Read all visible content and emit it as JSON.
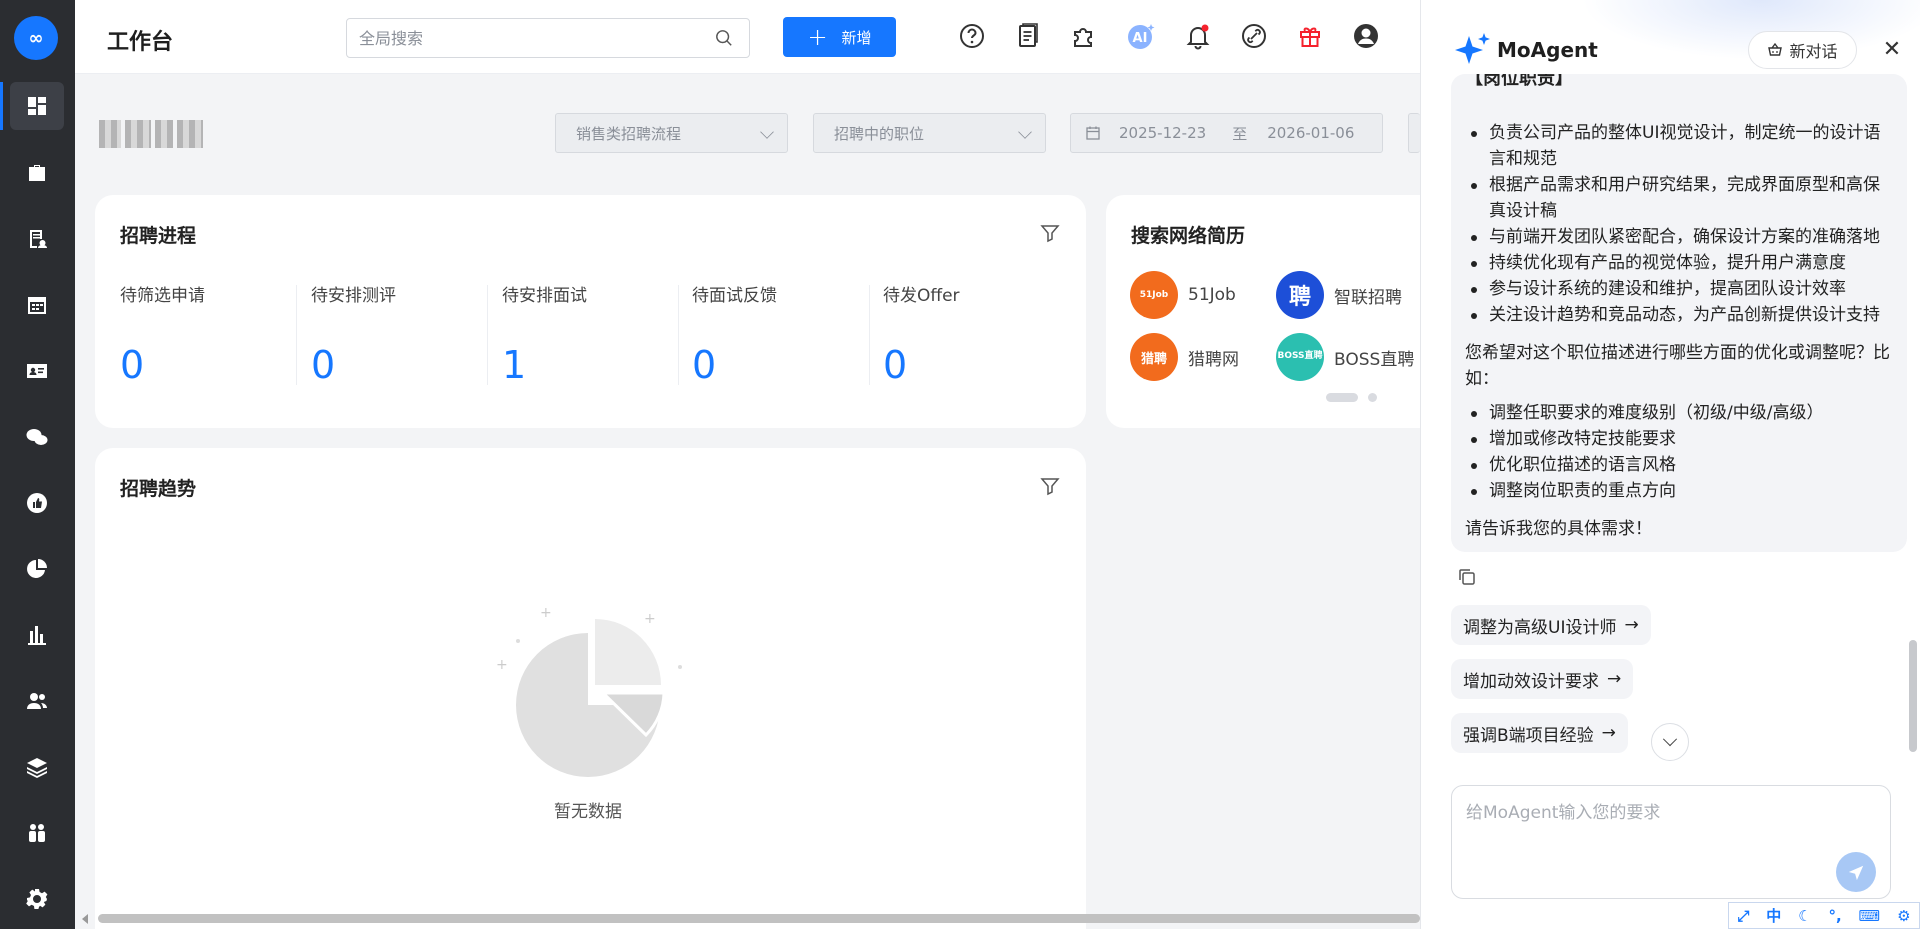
{
  "app": {
    "logo_text": "∞"
  },
  "sidebar": {
    "items": [
      {
        "name": "dashboard"
      },
      {
        "name": "jobs"
      },
      {
        "name": "resume"
      },
      {
        "name": "calendar"
      },
      {
        "name": "candidates"
      },
      {
        "name": "wechat"
      },
      {
        "name": "recommend"
      },
      {
        "name": "reports-pie"
      },
      {
        "name": "statistics"
      },
      {
        "name": "users"
      },
      {
        "name": "layers"
      },
      {
        "name": "team"
      },
      {
        "name": "settings"
      }
    ]
  },
  "header": {
    "title": "工作台",
    "search_placeholder": "全局搜索",
    "new_button": "新增"
  },
  "filters": {
    "process": "销售类招聘流程",
    "position": "招聘中的职位",
    "date_start": "2025-12-23",
    "date_sep": "至",
    "date_end": "2026-01-06"
  },
  "progress_card": {
    "title": "招聘进程",
    "stats": [
      {
        "label": "待筛选申请",
        "value": "0"
      },
      {
        "label": "待安排测评",
        "value": "0"
      },
      {
        "label": "待安排面试",
        "value": "1"
      },
      {
        "label": "待面试反馈",
        "value": "0"
      },
      {
        "label": "待发Offer",
        "value": "0"
      }
    ]
  },
  "resume_card": {
    "title": "搜索网络简历",
    "sites": [
      {
        "name": "51Job",
        "color": "#f26b1d",
        "badge": "51Job"
      },
      {
        "name": "智联招聘",
        "color": "#1d4fd8",
        "badge": "聘"
      },
      {
        "name": "猎聘网",
        "color": "#f26b1d",
        "badge": "猎聘"
      },
      {
        "name": "BOSS直聘",
        "color": "#2bbfb0",
        "badge": "BOSS直聘"
      }
    ]
  },
  "trend_card": {
    "title": "招聘趋势",
    "empty_text": "暂无数据"
  },
  "agent": {
    "title": "MoAgent",
    "new_chat": "新对话",
    "section_head": "【岗位职责】",
    "duties": [
      "负责公司产品的整体UI视觉设计，制定统一的设计语言和规范",
      "根据产品需求和用户研究结果，完成界面原型和高保真设计稿",
      "与前端开发团队紧密配合，确保设计方案的准确落地",
      "持续优化现有产品的视觉体验，提升用户满意度",
      "参与设计系统的建设和维护，提高团队设计效率",
      "关注设计趋势和竞品动态，为产品创新提供设计支持"
    ],
    "question": "您希望对这个职位描述进行哪些方面的优化或调整呢？比如：",
    "options": [
      "调整任职要求的难度级别（初级/中级/高级）",
      "增加或修改特定技能要求",
      "优化职位描述的语言风格",
      "调整岗位职责的重点方向"
    ],
    "closing": "请告诉我您的具体需求！",
    "suggestions": [
      "调整为高级UI设计师",
      "增加动效设计要求",
      "强调B端项目经验"
    ],
    "input_placeholder": "给MoAgent输入您的要求"
  },
  "ime": {
    "lang": "中"
  }
}
